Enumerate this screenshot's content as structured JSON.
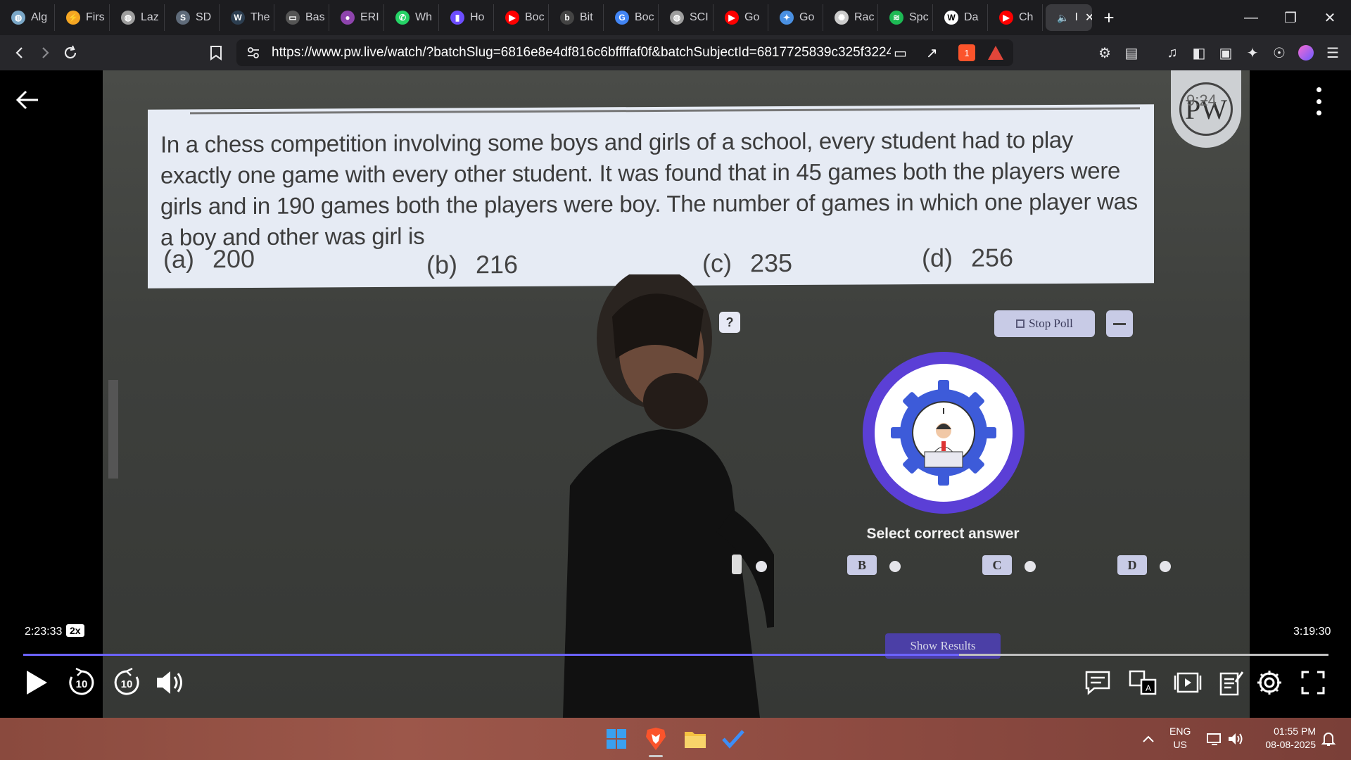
{
  "browser": {
    "tabs": [
      {
        "label": "Alg",
        "icon": "globe-icon",
        "color": "#7aa7c7"
      },
      {
        "label": "Firs",
        "icon": "lightning-icon",
        "color": "#f5a623"
      },
      {
        "label": "Laz",
        "icon": "globe-icon",
        "color": "#9e9e9e"
      },
      {
        "label": "SD",
        "icon": "sd-icon",
        "color": "#5f6b7a"
      },
      {
        "label": "The",
        "icon": "w3-icon",
        "color": "#2c3e50"
      },
      {
        "label": "Bas",
        "icon": "code-icon",
        "color": "#555"
      },
      {
        "label": "ERI",
        "icon": "brain-icon",
        "color": "#8e44ad"
      },
      {
        "label": "Wh",
        "icon": "whatsapp-icon",
        "color": "#25d366"
      },
      {
        "label": "Ho",
        "icon": "bookmark-icon",
        "color": "#6c4dff"
      },
      {
        "label": "Boc",
        "icon": "youtube-icon",
        "color": "#ff0000"
      },
      {
        "label": "Bit",
        "icon": "bit-icon",
        "color": "#444"
      },
      {
        "label": "Boc",
        "icon": "google-icon",
        "color": "#4285f4"
      },
      {
        "label": "SCI",
        "icon": "globe-icon",
        "color": "#9e9e9e"
      },
      {
        "label": "Go",
        "icon": "youtube-icon",
        "color": "#ff0000"
      },
      {
        "label": "Go",
        "icon": "gemini-icon",
        "color": "#4a90e2"
      },
      {
        "label": "Rac",
        "icon": "openai-icon",
        "color": "#cccccc"
      },
      {
        "label": "Spc",
        "icon": "spotify-icon",
        "color": "#1db954"
      },
      {
        "label": "Da",
        "icon": "wikipedia-icon",
        "color": "#ffffff"
      },
      {
        "label": "Ch",
        "icon": "youtube-icon",
        "color": "#ff0000"
      }
    ],
    "active_tab": {
      "label": "I",
      "icon": "speaker-icon"
    },
    "url": "https://www.pw.live/watch/?batchSlug=6816e8e4df816c6bffffaf0f&batchSubjectId=6817725839c325f3224e28d...",
    "brave_badge": "1"
  },
  "question": {
    "text": "In a chess competition involving some boys and girls of a school, every student had to play exactly one game with every other student. It was found that in 45 games both the players were girls and in 190 games both the players were boy. The number of games in which one player was a boy and other was girl is",
    "options": [
      {
        "letter": "(a)",
        "value": "200"
      },
      {
        "letter": "(b)",
        "value": "216"
      },
      {
        "letter": "(c)",
        "value": "235"
      },
      {
        "letter": "(d)",
        "value": "256"
      }
    ]
  },
  "logo": {
    "text": "PW",
    "overlay": "9:24"
  },
  "poll": {
    "stop_label": "Stop Poll",
    "question_mark": "?",
    "prompt": "Select correct answer",
    "answers": [
      "B",
      "C",
      "D"
    ],
    "show_results_label": "Show Results"
  },
  "player": {
    "current_time": "2:23:33",
    "duration": "3:19:30",
    "speed": "2x",
    "progress": 0.717,
    "skip_seconds": "10"
  },
  "taskbar": {
    "lang_line1": "ENG",
    "lang_line2": "US",
    "time": "01:55 PM",
    "date": "08-08-2025"
  }
}
